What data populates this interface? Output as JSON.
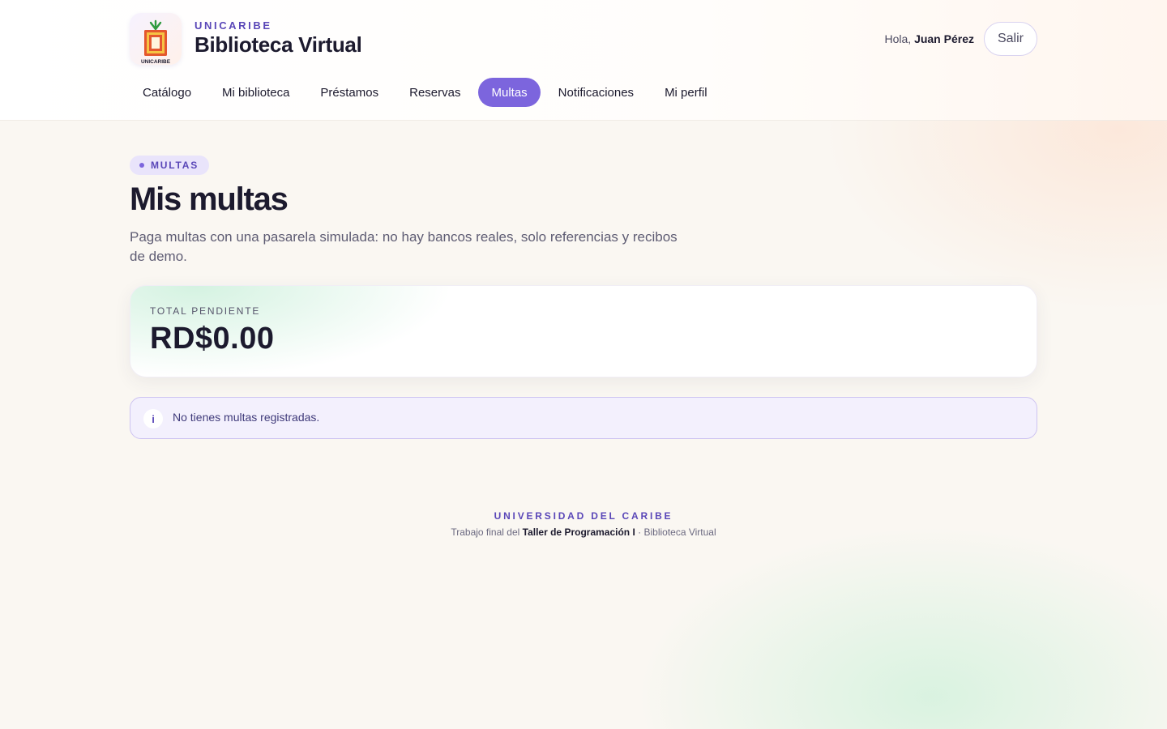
{
  "brand": {
    "logo_text": "UNICARIBE",
    "eyebrow": "UNICARIBE",
    "title": "Biblioteca Virtual"
  },
  "user": {
    "greeting": "Hola,",
    "name": "Juan Pérez",
    "logout_label": "Salir"
  },
  "nav": {
    "items": [
      {
        "label": "Catálogo",
        "active": false
      },
      {
        "label": "Mi biblioteca",
        "active": false
      },
      {
        "label": "Préstamos",
        "active": false
      },
      {
        "label": "Reservas",
        "active": false
      },
      {
        "label": "Multas",
        "active": true
      },
      {
        "label": "Notificaciones",
        "active": false
      },
      {
        "label": "Mi perfil",
        "active": false
      }
    ]
  },
  "main": {
    "chip": "MULTAS",
    "title": "Mis multas",
    "description": "Paga multas con una pasarela simulada: no hay bancos reales, solo referencias y recibos de demo.",
    "total_label": "TOTAL PENDIENTE",
    "total_value": "RD$0.00",
    "alert_icon": "i",
    "alert_text": "No tienes multas registradas."
  },
  "footer": {
    "org": "UNIVERSIDAD DEL CARIBE",
    "prefix": "Trabajo final del",
    "course": "Taller de Programación I",
    "suffix": "· Biblioteca Virtual"
  },
  "colors": {
    "accent": "#7c65dd",
    "accent_text": "#5a47b8",
    "ink": "#1c1a2e"
  }
}
